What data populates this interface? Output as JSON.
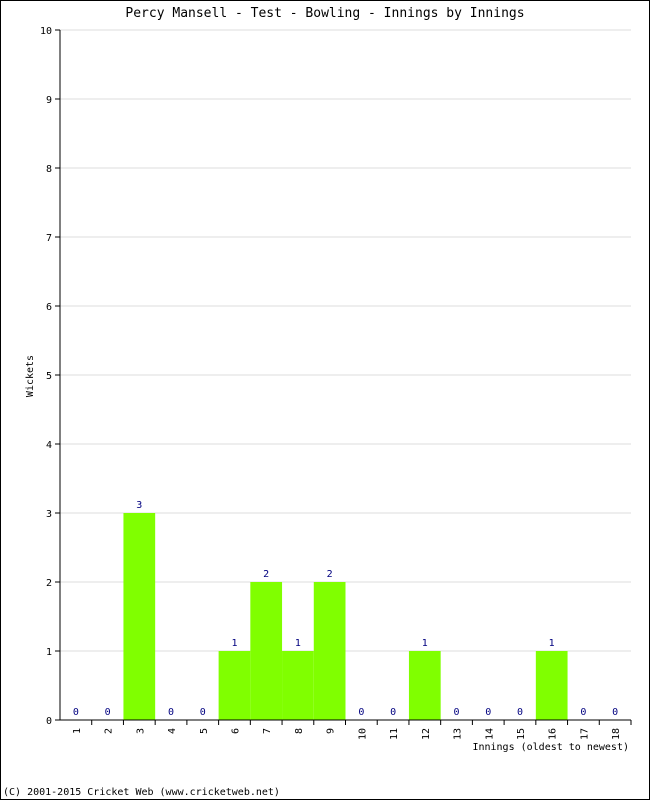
{
  "chart_data": {
    "type": "bar",
    "title": "Percy Mansell - Test - Bowling - Innings by Innings",
    "xlabel": "Innings (oldest to newest)",
    "ylabel": "Wickets",
    "categories": [
      "1",
      "2",
      "3",
      "4",
      "5",
      "6",
      "7",
      "8",
      "9",
      "10",
      "11",
      "12",
      "13",
      "14",
      "15",
      "16",
      "17",
      "18"
    ],
    "values": [
      0,
      0,
      3,
      0,
      0,
      1,
      2,
      1,
      2,
      0,
      0,
      1,
      0,
      0,
      0,
      1,
      0,
      0
    ],
    "ylim": [
      0,
      10
    ],
    "yticks": [
      0,
      1,
      2,
      3,
      4,
      5,
      6,
      7,
      8,
      9,
      10
    ],
    "grid": true,
    "bar_color": "#80ff00",
    "label_color": "#000080",
    "grid_color": "#dddddd"
  },
  "footer": "(C) 2001-2015 Cricket Web (www.cricketweb.net)"
}
